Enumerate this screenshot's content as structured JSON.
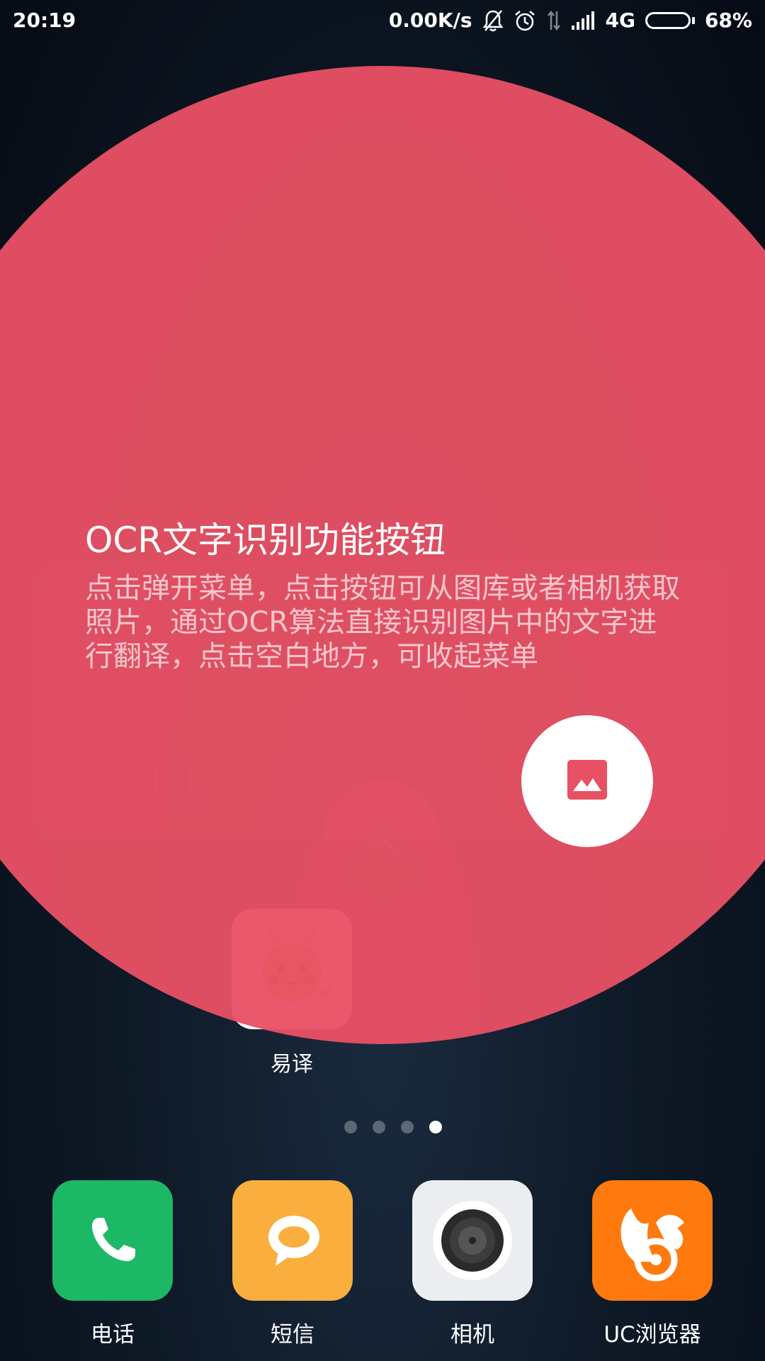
{
  "status_bar": {
    "time": "20:19",
    "network_speed": "0.00K/s",
    "network_type": "4G",
    "battery_percent": "68%",
    "battery_level": 0.68,
    "icons": [
      "bell-off-icon",
      "alarm-icon",
      "data-arrows-icon",
      "signal-icon",
      "battery-icon"
    ]
  },
  "tutorial": {
    "title": "OCR文字识别功能按钮",
    "description": "点击弹开菜单，点击按钮可从图库或者相机获取照片，通过OCR算法直接识别图片中的文字进行翻译，点击空白地方，可收起菜单",
    "button_icon": "image-icon",
    "accent_color": "#E85064"
  },
  "home": {
    "app": {
      "label": "易译",
      "icon": "pikachu-icon"
    },
    "page_indicator": {
      "count": 4,
      "active_index": 3
    }
  },
  "dock": [
    {
      "label": "电话",
      "icon": "phone-icon",
      "color": "#1CB866"
    },
    {
      "label": "短信",
      "icon": "message-icon",
      "color": "#F9AE3E"
    },
    {
      "label": "相机",
      "icon": "camera-icon",
      "color": "#ECEDF0"
    },
    {
      "label": "UC浏览器",
      "icon": "uc-squirrel-icon",
      "color": "#FF7A0E"
    }
  ]
}
